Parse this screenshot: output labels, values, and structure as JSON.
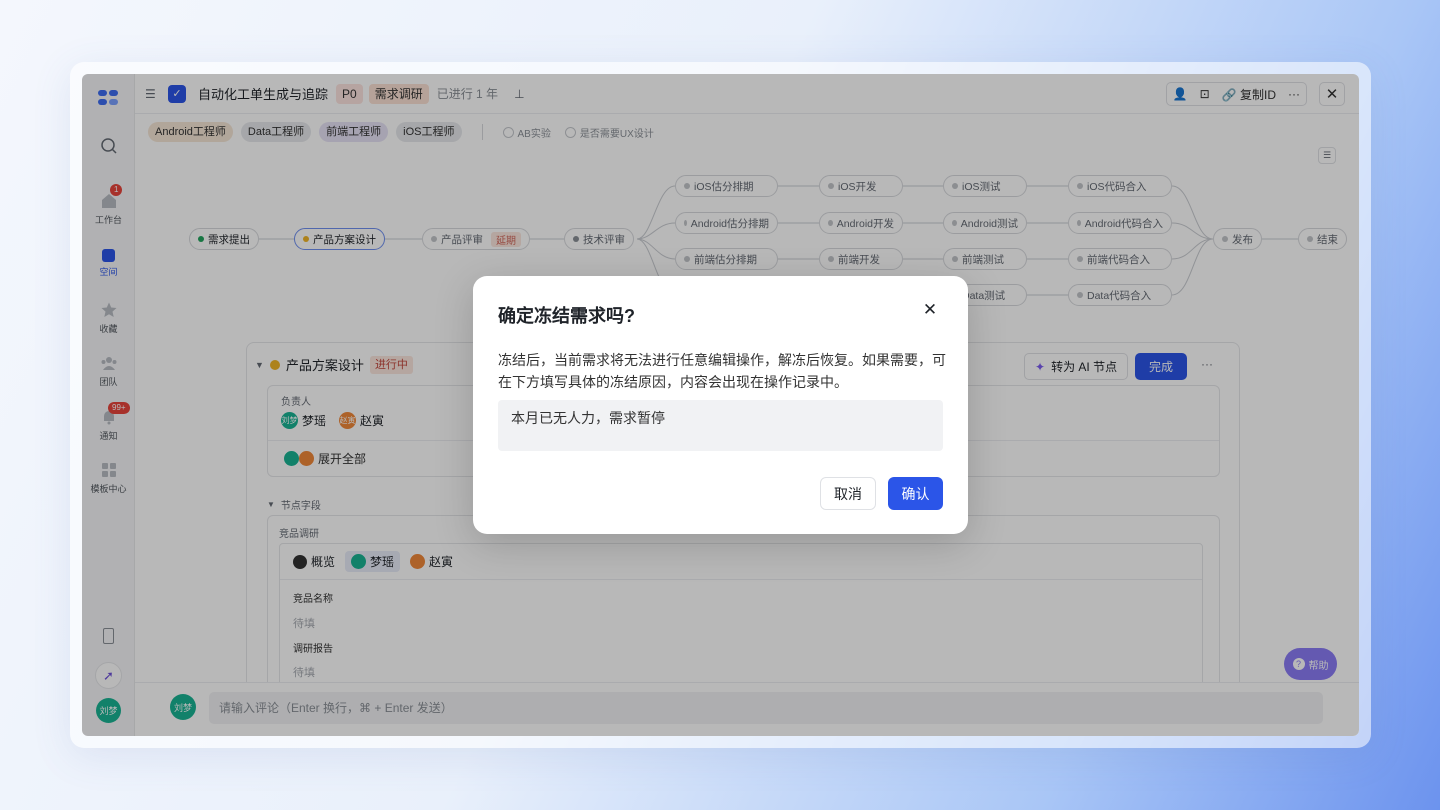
{
  "header": {
    "title": "自动化工单生成与追踪",
    "priority": "P0",
    "stage": "需求调研",
    "elapsed": "已进行 1 年",
    "copy_id": "复制ID"
  },
  "roles": [
    "Android工程师",
    "Data工程师",
    "前端工程师",
    "iOS工程师"
  ],
  "options": [
    "AB实验",
    "是否需要UX设计"
  ],
  "sidebar": {
    "workbench": "工作台",
    "workbench_badge": "1",
    "space": "空间",
    "favorites": "收藏",
    "team": "团队",
    "notify": "通知",
    "notify_badge": "99+",
    "templates": "模板中心",
    "user": "刘梦"
  },
  "flow": {
    "req": "需求提出",
    "design": "产品方案设计",
    "review": "产品评审",
    "delay": "延期",
    "tech": "技术评审",
    "ios_est": "iOS估分排期",
    "and_est": "Android估分排期",
    "fe_est": "前端估分排期",
    "ios_dev": "iOS开发",
    "and_dev": "Android开发",
    "fe_dev": "前端开发",
    "ios_test": "iOS测试",
    "and_test": "Android测试",
    "fe_test": "前端测试",
    "data_test": "Data测试",
    "ios_merge": "iOS代码合入",
    "and_merge": "Android代码合入",
    "fe_merge": "前端代码合入",
    "data_merge": "Data代码合入",
    "release": "发布",
    "end": "结束"
  },
  "panel": {
    "title": "产品方案设计",
    "status": "进行中",
    "ai_btn": "转为 AI 节点",
    "done_btn": "完成",
    "owner_label": "负责人",
    "owner1": "梦瑶",
    "owner2": "赵寅",
    "expand": "展开全部",
    "fields_label": "节点字段",
    "competitor": "竞品调研",
    "overview": "概览",
    "name_label": "竞品名称",
    "pending1": "待填",
    "report_label": "调研报告",
    "pending2": "待填",
    "av1": "刘梦",
    "av2": "赵寅"
  },
  "comment": {
    "avatar": "刘梦",
    "placeholder": "请输入评论（Enter 换行，⌘ + Enter 发送）"
  },
  "help": "帮助",
  "dialog": {
    "title": "确定冻结需求吗?",
    "body": "冻结后，当前需求将无法进行任意编辑操作，解冻后恢复。如果需要，可在下方填写具体的冻结原因，内容会出现在操作记录中。",
    "reason": "本月已无人力，需求暂停",
    "cancel": "取消",
    "confirm": "确认"
  },
  "colors": {
    "primary": "#2b55e8",
    "overlay": "rgba(0,0,0,0.28)",
    "accent_purple": "#8b7cf6",
    "green_avatar": "#1ab394",
    "orange_avatar": "#f0883a"
  }
}
